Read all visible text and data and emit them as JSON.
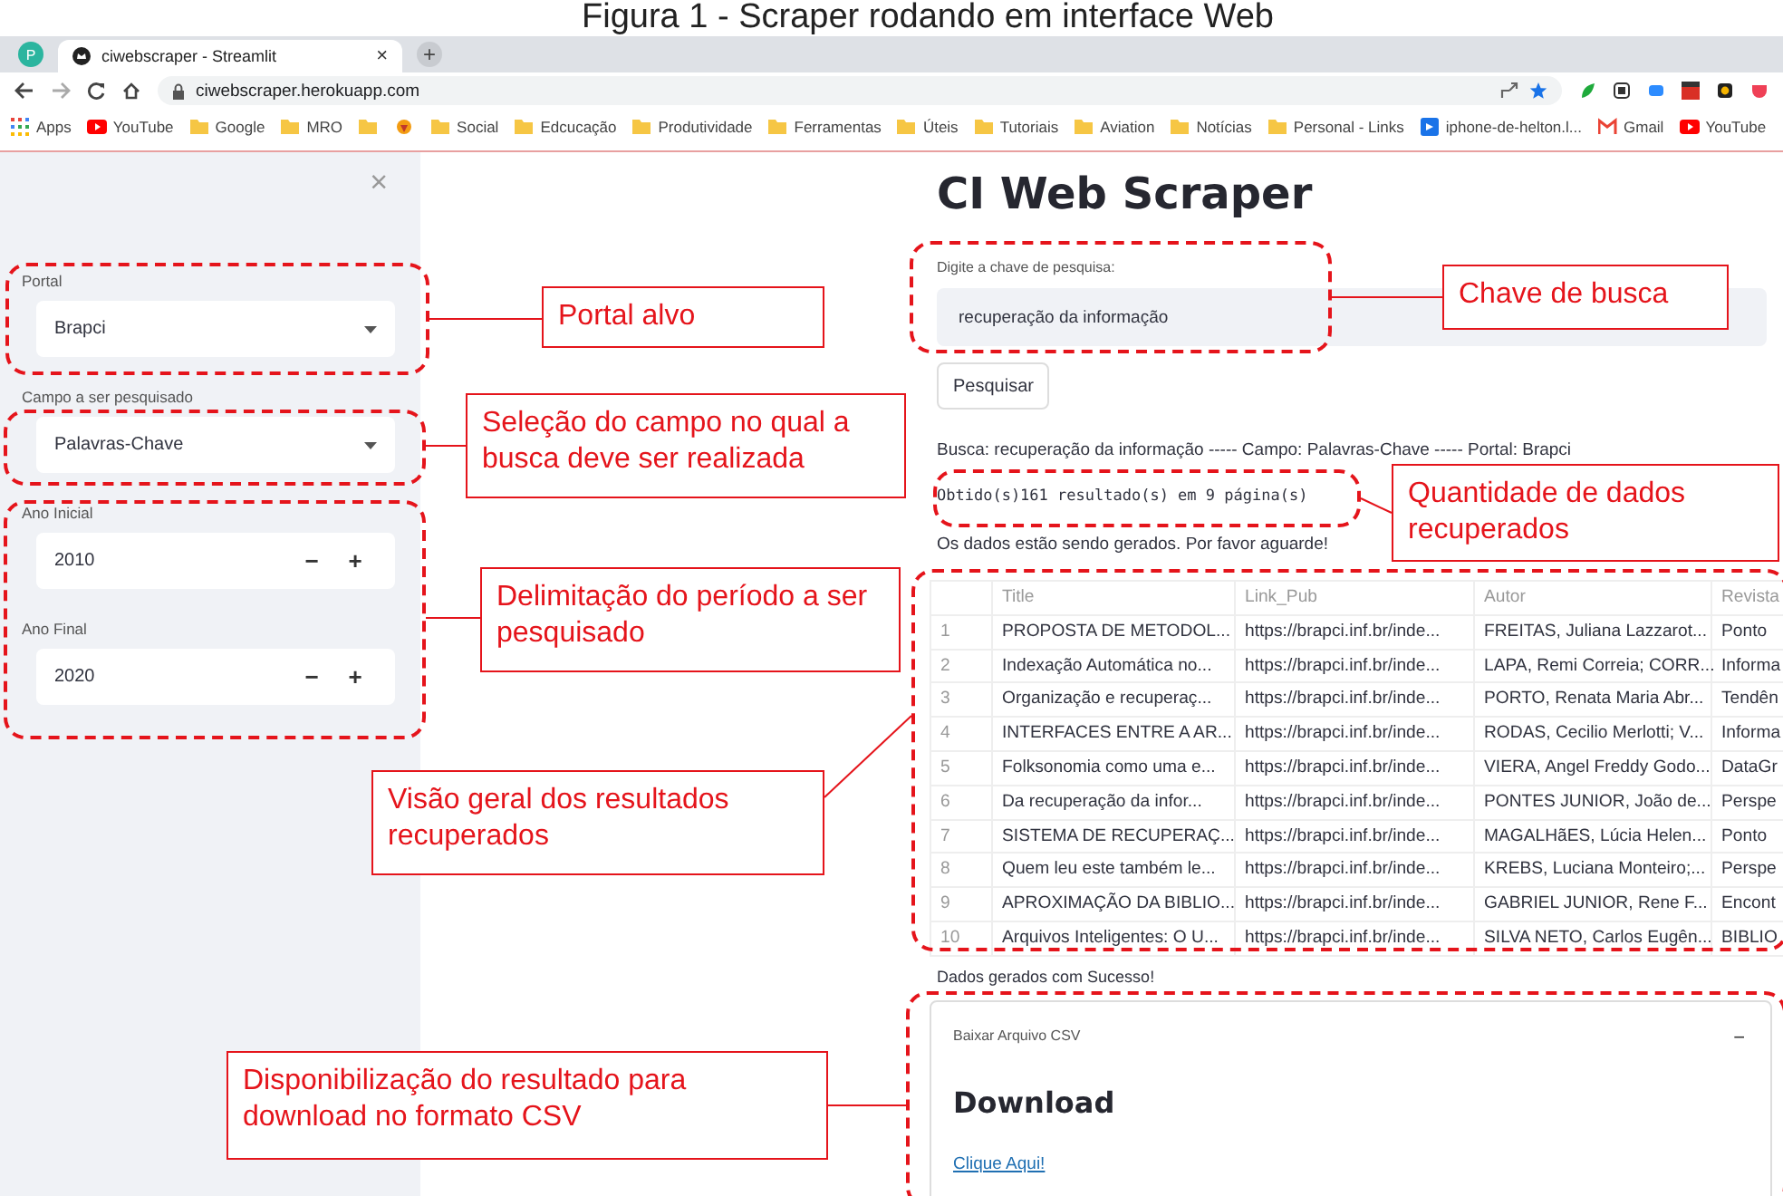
{
  "caption": "Figura 1 - Scraper rodando em interface Web",
  "browser": {
    "profile": "P",
    "tabs": [
      {
        "title": "ciwebscraper - Streamlit",
        "close": "×",
        "selected": true
      }
    ],
    "new_tab": "+",
    "url": "ciwebscraper.herokuapp.com",
    "bookmarks": [
      {
        "kind": "apps",
        "label": "Apps"
      },
      {
        "kind": "youtube",
        "label": "YouTube"
      },
      {
        "kind": "folder",
        "label": "Google"
      },
      {
        "kind": "folder",
        "label": "MRO"
      },
      {
        "kind": "folder"
      },
      {
        "kind": "favicon"
      },
      {
        "kind": "folder",
        "label": "Social"
      },
      {
        "kind": "folder",
        "label": "Edcucação"
      },
      {
        "kind": "folder",
        "label": "Produtividade"
      },
      {
        "kind": "folder",
        "label": "Ferramentas"
      },
      {
        "kind": "folder",
        "label": "Úteis"
      },
      {
        "kind": "folder",
        "label": "Tutoriais"
      },
      {
        "kind": "folder",
        "label": "Aviation"
      },
      {
        "kind": "folder",
        "label": "Notícias"
      },
      {
        "kind": "folder",
        "label": "Personal - Links"
      },
      {
        "kind": "site",
        "label": "iphone-de-helton.l..."
      },
      {
        "kind": "gmail",
        "label": "Gmail"
      },
      {
        "kind": "youtube",
        "label": "YouTube"
      }
    ]
  },
  "sidebar": {
    "close": "×",
    "fields": [
      {
        "kind": "select",
        "label": "Portal",
        "value": "Brapci"
      },
      {
        "kind": "select",
        "label": "Campo a ser pesquisado",
        "value": "Palavras-Chave"
      },
      {
        "kind": "number",
        "label": "Ano Inicial",
        "value": "2010",
        "minus": "−",
        "plus": "+"
      },
      {
        "kind": "number",
        "label": "Ano Final",
        "value": "2020",
        "minus": "−",
        "plus": "+"
      }
    ]
  },
  "main": {
    "title": "CI Web Scraper",
    "search": {
      "label": "Digite a chave de pesquisa:",
      "value": "recuperação da informação"
    },
    "button": "Pesquisar",
    "summary": "Busca: recuperação da informação ----- Campo: Palavras-Chave ----- Portal: Brapci",
    "result_count": "Obtido(s)161 resultado(s) em 9 página(s)",
    "status": "Os dados estão sendo gerados. Por favor aguarde!",
    "table": {
      "columns": [
        "Title",
        "Link_Pub",
        "Autor",
        "Revista"
      ],
      "rows": [
        {
          "index": "1",
          "cells": [
            "PROPOSTA DE METODOL...",
            "https://brapci.inf.br/inde...",
            "FREITAS, Juliana Lazzarot...",
            "Ponto"
          ]
        },
        {
          "index": "2",
          "cells": [
            "Indexação Automática no...",
            "https://brapci.inf.br/inde...",
            "LAPA, Remi Correia; CORR...",
            "Informa"
          ]
        },
        {
          "index": "3",
          "cells": [
            "Organização e recuperaç...",
            "https://brapci.inf.br/inde...",
            "PORTO, Renata Maria Abr...",
            "Tendên"
          ]
        },
        {
          "index": "4",
          "cells": [
            "INTERFACES ENTRE A AR...",
            "https://brapci.inf.br/inde...",
            "RODAS, Cecilio Merlotti; V...",
            "Informa"
          ]
        },
        {
          "index": "5",
          "cells": [
            "Folksonomia como uma e...",
            "https://brapci.inf.br/inde...",
            "VIERA, Angel Freddy Godo...",
            "DataGr"
          ]
        },
        {
          "index": "6",
          "cells": [
            "Da recuperação da infor...",
            "https://brapci.inf.br/inde...",
            "PONTES JUNIOR, João de...",
            "Perspe"
          ]
        },
        {
          "index": "7",
          "cells": [
            "SISTEMA DE RECUPERAÇ...",
            "https://brapci.inf.br/inde...",
            "MAGALHãES, Lúcia Helen...",
            "Ponto"
          ]
        },
        {
          "index": "8",
          "cells": [
            "Quem leu este também le...",
            "https://brapci.inf.br/inde...",
            "KREBS, Luciana Monteiro;...",
            "Perspe"
          ]
        },
        {
          "index": "9",
          "cells": [
            "APROXIMAÇÃO DA BIBLIO...",
            "https://brapci.inf.br/inde...",
            "GABRIEL JUNIOR, Rene F...",
            "Encont"
          ]
        },
        {
          "index": "10",
          "cells": [
            "Arquivos Inteligentes: O U...",
            "https://brapci.inf.br/inde...",
            "SILVA NETO, Carlos Eugên...",
            "BIBLIO"
          ]
        }
      ]
    },
    "success": "Dados gerados com Sucesso!",
    "expander": {
      "title": "Baixar Arquivo CSV",
      "toggle": "−",
      "expanded": true,
      "heading": "Download",
      "link": "Clique Aqui!"
    }
  },
  "annotations": [
    {
      "text": "Portal alvo"
    },
    {
      "text": "Seleção do campo no qual a busca deve ser realizada"
    },
    {
      "text": "Delimitação do período a ser pesquisado"
    },
    {
      "text": "Chave de busca"
    },
    {
      "text": "Quantidade de dados recuperados"
    },
    {
      "text": "Visão geral dos resultados recuperados"
    },
    {
      "text": "Disponibilização do resultado para download no formato CSV"
    }
  ]
}
